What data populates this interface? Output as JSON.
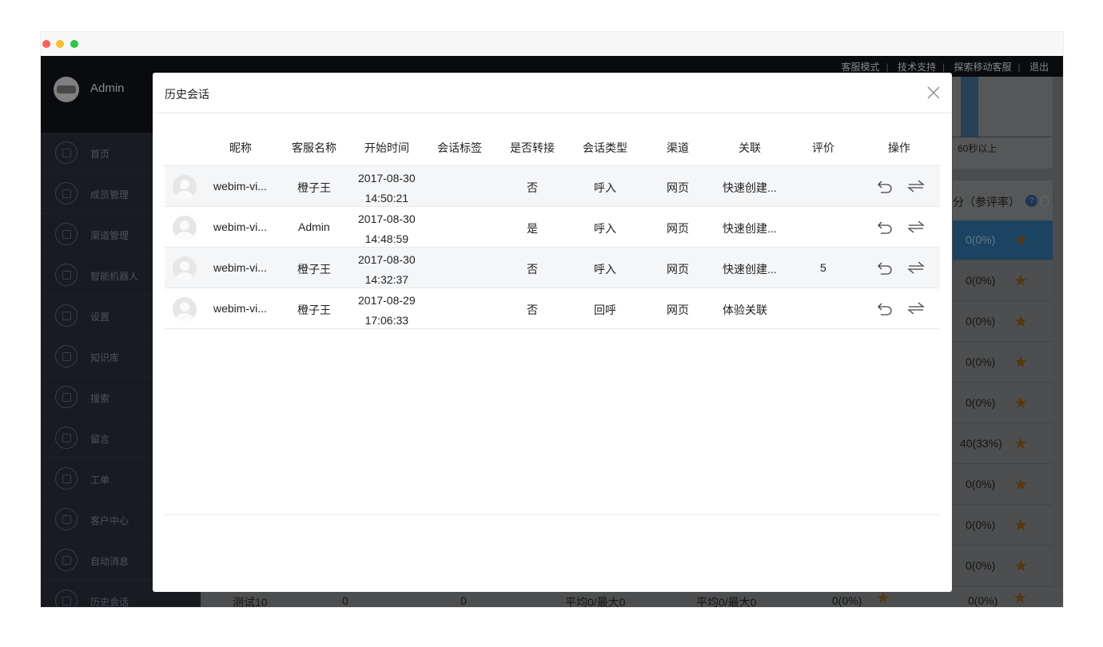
{
  "app": {
    "admin_name": "Admin",
    "top_links": [
      "客服模式",
      "技术支持",
      "探索移动客服",
      "退出"
    ],
    "menu": [
      {
        "label": "首页",
        "icon": "home-icon"
      },
      {
        "label": "成员管理",
        "icon": "user-icon"
      },
      {
        "label": "渠道管理",
        "icon": "channel-icon"
      },
      {
        "label": "智能机器人",
        "icon": "robot-icon"
      },
      {
        "label": "设置",
        "icon": "gear-icon"
      },
      {
        "label": "知识库",
        "icon": "book-icon"
      },
      {
        "label": "搜索",
        "icon": "search-icon"
      },
      {
        "label": "留言",
        "icon": "edit-icon"
      },
      {
        "label": "工单",
        "icon": "ticket-icon"
      },
      {
        "label": "客户中心",
        "icon": "customer-icon"
      },
      {
        "label": "自动消息",
        "icon": "message-icon"
      },
      {
        "label": "历史会话",
        "icon": "history-icon"
      }
    ],
    "background": {
      "chart_label": "60秒以上",
      "score_header": "分（参评率）",
      "score_rows": [
        "0(0%)",
        "0(0%)",
        "0(0%)",
        "0(0%)",
        "0(0%)",
        "40(33%)",
        "0(0%)",
        "0(0%)",
        "0(0%)"
      ],
      "bottom_row": [
        "测试10",
        "0",
        "0",
        "平均0/最大0",
        "平均0/最大0",
        "0(0%)",
        "0(0%)"
      ]
    }
  },
  "modal": {
    "title": "历史会话",
    "columns": [
      "昵称",
      "客服名称",
      "开始时间",
      "会话标签",
      "是否转接",
      "会话类型",
      "渠道",
      "关联",
      "评价",
      "操作"
    ],
    "rows": [
      {
        "nickname": "webim-vi...",
        "agent": "橙子王",
        "date": "2017-08-30",
        "time": "14:50:21",
        "tag": "",
        "transfer": "否",
        "type": "呼入",
        "channel": "网页",
        "link": "快速创建...",
        "rating": ""
      },
      {
        "nickname": "webim-vi...",
        "agent": "Admin",
        "date": "2017-08-30",
        "time": "14:48:59",
        "tag": "",
        "transfer": "是",
        "type": "呼入",
        "channel": "网页",
        "link": "快速创建...",
        "rating": ""
      },
      {
        "nickname": "webim-vi...",
        "agent": "橙子王",
        "date": "2017-08-30",
        "time": "14:32:37",
        "tag": "",
        "transfer": "否",
        "type": "呼入",
        "channel": "网页",
        "link": "快速创建...",
        "rating": "5"
      },
      {
        "nickname": "webim-vi...",
        "agent": "橙子王",
        "date": "2017-08-29",
        "time": "17:06:33",
        "tag": "",
        "transfer": "否",
        "type": "回呼",
        "channel": "网页",
        "link": "体验关联",
        "rating": ""
      }
    ]
  }
}
